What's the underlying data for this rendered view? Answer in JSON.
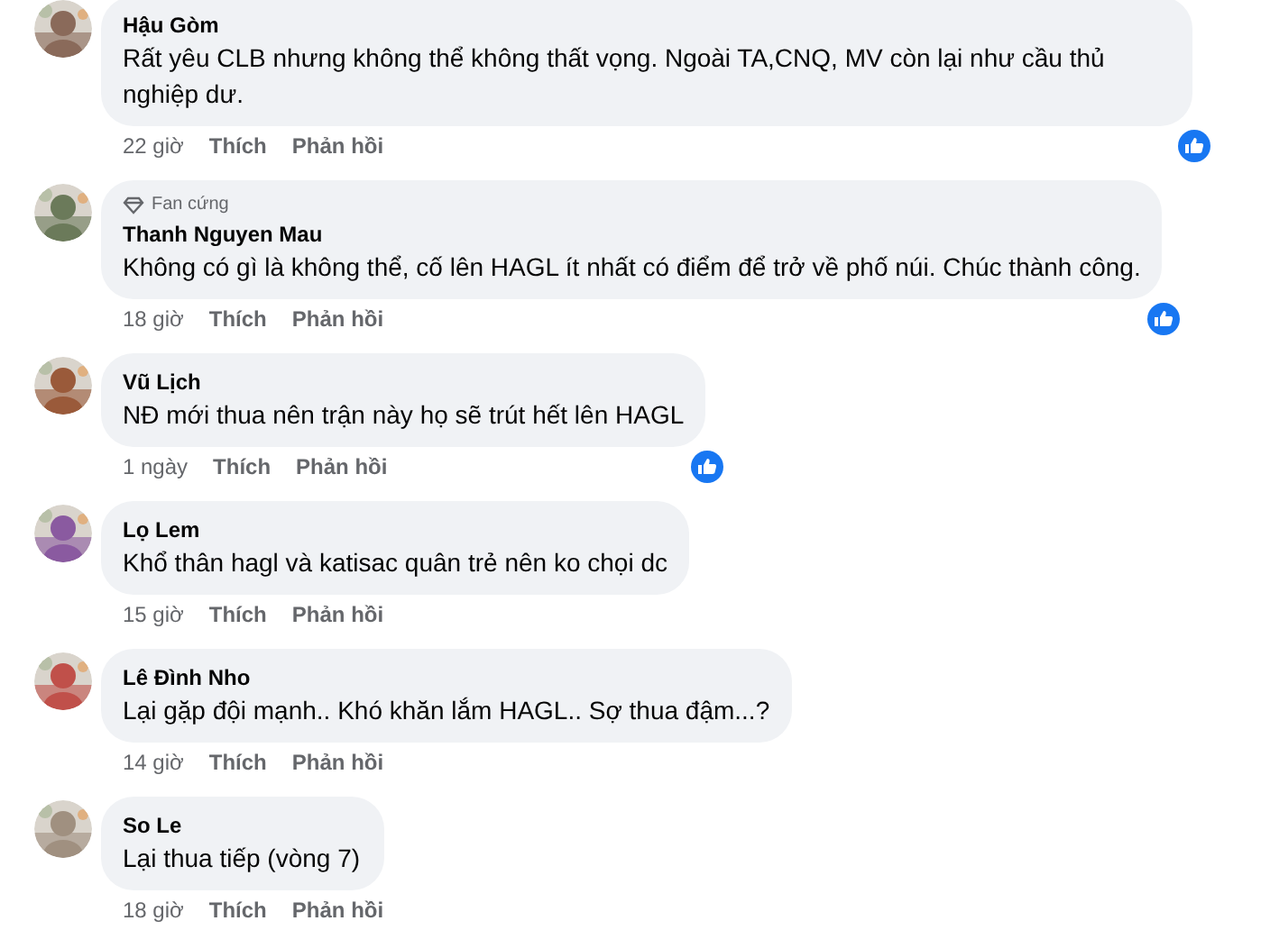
{
  "comments": [
    {
      "author": "Hậu Gòm",
      "text": "Rất yêu CLB nhưng không thể không thất vọng. Ngoài TA,CNQ, MV còn lại như cầu thủ nghiệp dư.",
      "time": "22 giờ",
      "like": "Thích",
      "reply": "Phản hồi",
      "liked": true
    },
    {
      "author": "Thanh Nguyen Mau",
      "badge": "Fan cứng",
      "text": "Không có gì là không thể, cố lên HAGL ít nhất có điểm để trở về phố núi. Chúc thành công.",
      "time": "18 giờ",
      "like": "Thích",
      "reply": "Phản hồi",
      "liked": true
    },
    {
      "author": "Vũ Lịch",
      "text": "NĐ mới thua nên trận này họ sẽ trút hết lên HAGL",
      "time": "1 ngày",
      "like": "Thích",
      "reply": "Phản hồi",
      "liked": true
    },
    {
      "author": "Lọ Lem",
      "text": "Khổ thân hagl và katisac quân trẻ nên ko chọi dc",
      "time": "15 giờ",
      "like": "Thích",
      "reply": "Phản hồi",
      "liked": false
    },
    {
      "author": "Lê Đình Nho",
      "text": "Lại gặp đội mạnh.. Khó khăn lắm HAGL.. Sợ thua đậm...?",
      "time": "14 giờ",
      "like": "Thích",
      "reply": "Phản hồi",
      "liked": false
    },
    {
      "author": "So Le",
      "text": "Lại thua tiếp (vòng 7)",
      "time": "18 giờ",
      "like": "Thích",
      "reply": "Phản hồi",
      "liked": false
    }
  ]
}
